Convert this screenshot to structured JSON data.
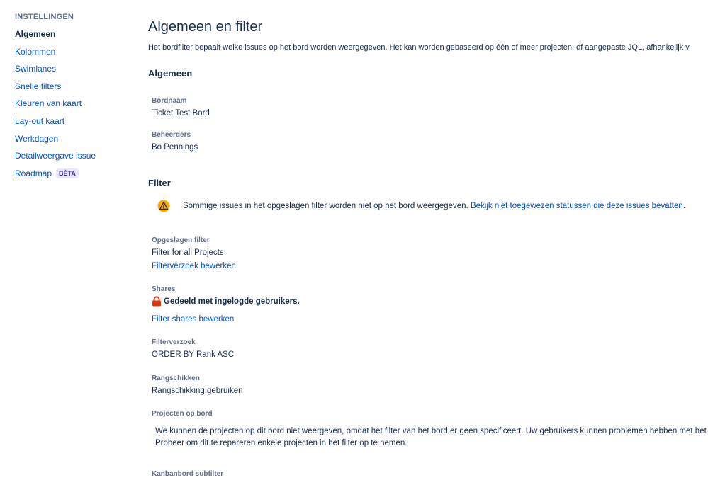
{
  "sidebar": {
    "heading": "INSTELLINGEN",
    "items": [
      {
        "label": "Algemeen"
      },
      {
        "label": "Kolommen"
      },
      {
        "label": "Swimlanes"
      },
      {
        "label": "Snelle filters"
      },
      {
        "label": "Kleuren van kaart"
      },
      {
        "label": "Lay-out kaart"
      },
      {
        "label": "Werkdagen"
      },
      {
        "label": "Detailweergave issue"
      },
      {
        "label": "Roadmap",
        "badge": "BÈTA"
      }
    ],
    "active_item": "Algemeen"
  },
  "main": {
    "title": "Algemeen en filter",
    "description": "Het bordfilter bepaalt welke issues op het bord worden weergegeven. Het kan worden gebaseerd op één of meer projecten, of aangepaste JQL, afhankelijk v",
    "general": {
      "heading": "Algemeen",
      "board_name_label": "Bordnaam",
      "board_name_value": "Ticket Test Bord",
      "admins_label": "Beheerders",
      "admins_value": "Bo Pennings"
    },
    "filter": {
      "heading": "Filter",
      "warning_text": "Sommige issues in het opgeslagen filter worden niet op het bord weergegeven.",
      "warning_link": "Bekijk niet toegewezen statussen die deze issues bevatten",
      "warning_suffix": ".",
      "saved_filter_label": "Opgeslagen filter",
      "saved_filter_value": "Filter for all Projects",
      "edit_query_link": "Filterverzoek bewerken",
      "shares_label": "Shares",
      "shares_value": "Gedeeld met ingelogde gebruikers.",
      "edit_shares_link": "Filter shares bewerken",
      "query_label": "Filterverzoek",
      "query_value": "ORDER BY Rank ASC",
      "ranking_label": "Rangschikken",
      "ranking_value": "Rangschikking gebruiken",
      "projects_label": "Projecten op bord",
      "projects_message_line1": "We kunnen de projecten op dit bord niet weergeven, omdat het filter van het bord er geen specificeert. Uw gebruikers kunnen problemen hebben met het",
      "projects_message_line2": "Probeer om dit te repareren enkele projecten in het filter op te nemen.",
      "subfilter_label": "Kanbanbord subfilter"
    }
  },
  "colors": {
    "link": "#0052cc",
    "text": "#172b4d",
    "muted": "#5e6c84",
    "warning": "#ffab00",
    "lock": "#de350b",
    "badge_bg": "#eae6ff",
    "badge_text": "#403294"
  },
  "icons": {
    "warning": "warning-icon",
    "shares": "lock-icon"
  }
}
